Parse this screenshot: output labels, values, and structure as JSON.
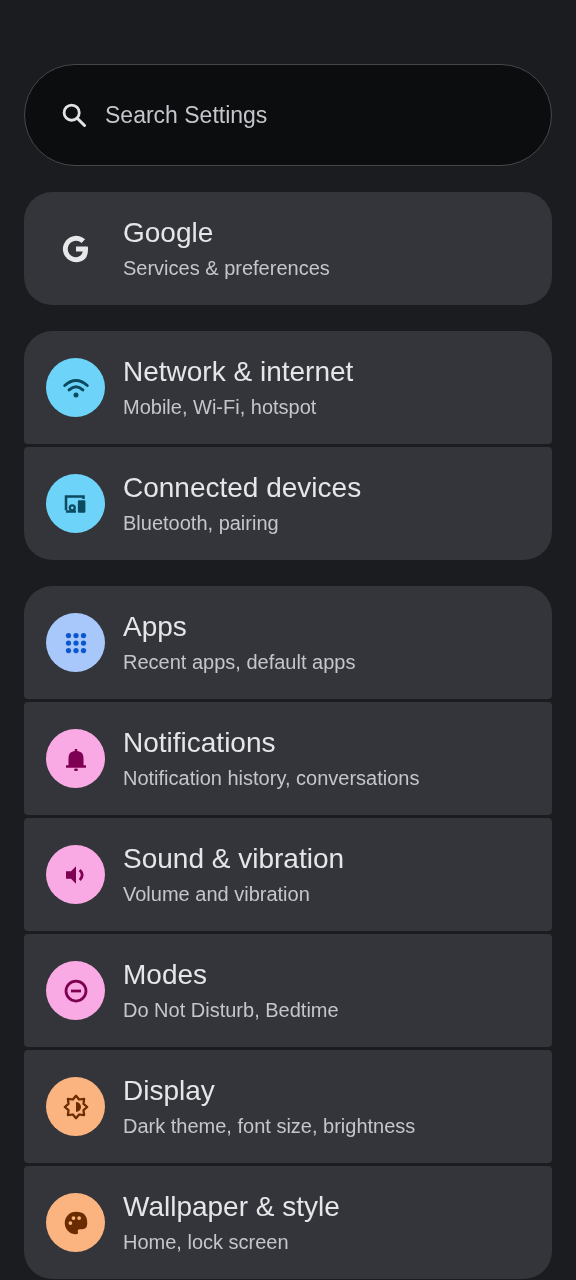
{
  "search": {
    "placeholder": "Search Settings"
  },
  "groups": [
    {
      "items": [
        {
          "title": "Google",
          "subtitle": "Services & preferences"
        }
      ]
    },
    {
      "items": [
        {
          "title": "Network & internet",
          "subtitle": "Mobile, Wi-Fi, hotspot",
          "color": "#6dd3f8"
        },
        {
          "title": "Connected devices",
          "subtitle": "Bluetooth, pairing",
          "color": "#6dd3f8"
        }
      ]
    },
    {
      "items": [
        {
          "title": "Apps",
          "subtitle": "Recent apps, default apps",
          "color": "#a8c7fa"
        },
        {
          "title": "Notifications",
          "subtitle": "Notification history, conversations",
          "color": "#f9a9e3"
        },
        {
          "title": "Sound & vibration",
          "subtitle": "Volume and vibration",
          "color": "#f9a9e3"
        },
        {
          "title": "Modes",
          "subtitle": "Do Not Disturb, Bedtime",
          "color": "#f9a9e3"
        },
        {
          "title": "Display",
          "subtitle": "Dark theme, font size, brightness",
          "color": "#fbb47f"
        },
        {
          "title": "Wallpaper & style",
          "subtitle": "Home, lock screen",
          "color": "#fbb47f"
        }
      ]
    }
  ]
}
